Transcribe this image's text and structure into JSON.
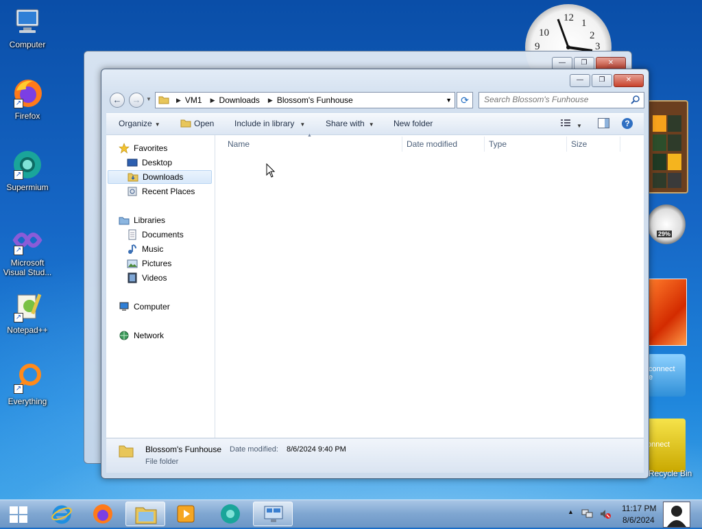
{
  "desktop": {
    "icons": [
      {
        "label": "Computer",
        "icon": "computer-icon"
      },
      {
        "label": "Firefox",
        "icon": "firefox-icon"
      },
      {
        "label": "Supermium",
        "icon": "supermium-icon"
      },
      {
        "label": "Microsoft\nVisual Stud...",
        "icon": "visual-studio-icon"
      },
      {
        "label": "Notepad++",
        "icon": "notepadpp-icon"
      },
      {
        "label": "Everything",
        "icon": "everything-icon"
      }
    ],
    "gadgets": {
      "clock_numbers": [
        "12",
        "1",
        "2",
        "3",
        "9",
        "10"
      ],
      "cpu_meter": "29%",
      "connect_text_1": "connect\ne",
      "connect_text_2": "onnect",
      "bin_label": "Recycle Bin"
    }
  },
  "window": {
    "controls": {
      "minimize": "—",
      "maximize": "❐",
      "close": "✕"
    },
    "address": {
      "segments": [
        "VM1",
        "Downloads",
        "Blossom's Funhouse"
      ]
    },
    "search_placeholder": "Search Blossom's Funhouse",
    "toolbar": {
      "organize": "Organize",
      "open": "Open",
      "include_in_library": "Include in library",
      "share_with": "Share with",
      "new_folder": "New folder"
    },
    "nav": {
      "favorites": "Favorites",
      "desktop": "Desktop",
      "downloads": "Downloads",
      "recent_places": "Recent Places",
      "libraries": "Libraries",
      "documents": "Documents",
      "music": "Music",
      "pictures": "Pictures",
      "videos": "Videos",
      "computer": "Computer",
      "network": "Network"
    },
    "columns": {
      "name": "Name",
      "date_modified": "Date modified",
      "type": "Type",
      "size": "Size"
    },
    "details": {
      "name": "Blossom's Funhouse",
      "date_label": "Date modified:",
      "date_value": "8/6/2024 9:40 PM",
      "type": "File folder"
    }
  },
  "taskbar": {
    "apps": [
      "start-icon",
      "internet-explorer-icon",
      "firefox-icon",
      "file-explorer-icon",
      "media-player-icon",
      "supermium-icon",
      "remote-desktop-icon"
    ],
    "time": "11:17 PM",
    "date": "8/6/2024",
    "tray_arrow": "▲"
  }
}
